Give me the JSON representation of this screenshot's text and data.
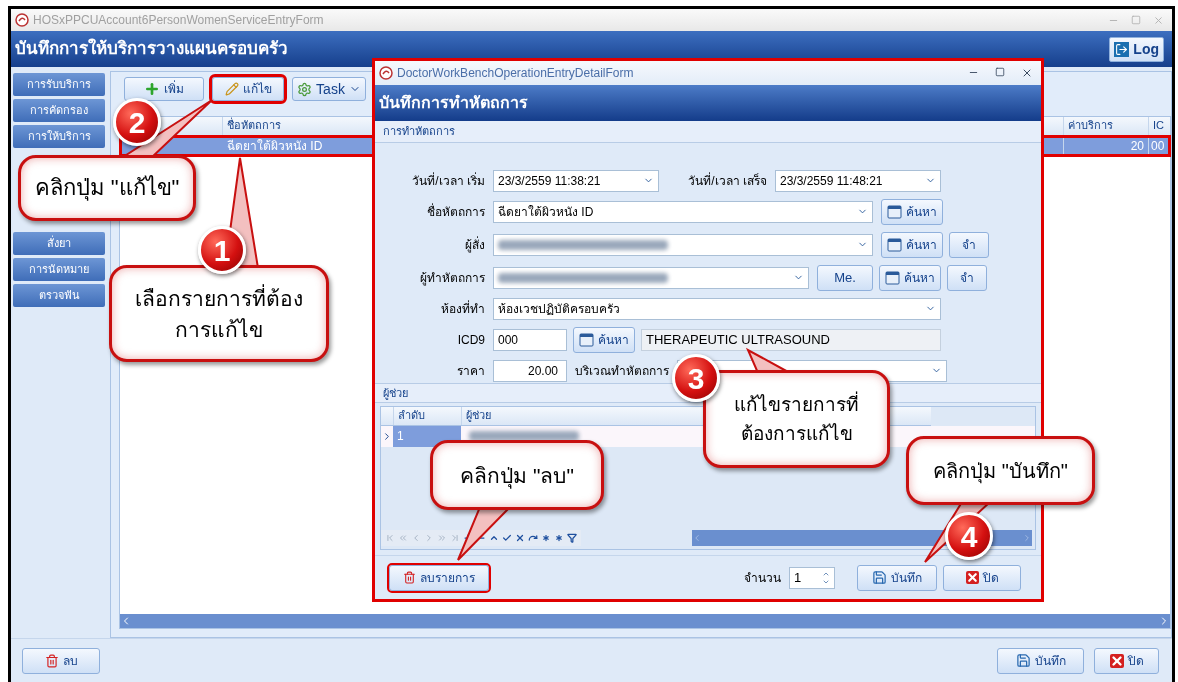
{
  "window": {
    "title": "HOSxPPCUAccount6PersonWomenServiceEntryForm",
    "header": "บันทึกการให้บริการวางแผนครอบครัว",
    "log_button": "Log"
  },
  "sidebar": {
    "items_top": [
      {
        "label": "การรับบริการ"
      },
      {
        "label": "การคัดกรอง"
      },
      {
        "label": "การให้บริการ"
      }
    ],
    "items_bottom": [
      {
        "label": "สั่งยา"
      },
      {
        "label": "การนัดหมาย"
      },
      {
        "label": "ตรวจฟัน"
      }
    ]
  },
  "toolbar": [
    {
      "label": "เพิ่ม",
      "kind": "add",
      "highlighted": false
    },
    {
      "label": "แก้ไข",
      "kind": "edit",
      "highlighted": true
    },
    {
      "label": "Task",
      "kind": "menu",
      "highlighted": false
    }
  ],
  "table": {
    "columns": [
      "ชื่อหัตถการ",
      "ค่าบริการ",
      "IC"
    ],
    "rows": [
      {
        "cells": [
          "ฉีดยาใต้ผิวหนัง ID",
          "20",
          "00"
        ],
        "selected": true,
        "highlighted": true
      }
    ]
  },
  "bottom_buttons": [
    {
      "label": "ลบ",
      "kind": "delete"
    },
    {
      "label": "บันทึก",
      "kind": "save"
    },
    {
      "label": "ปิด",
      "kind": "close"
    }
  ],
  "dialog": {
    "title": "DoctorWorkBenchOperationEntryDetailForm",
    "header": "บันทึกการทำหัตถการ",
    "section": "การทำหัตถการ",
    "highlighted": true,
    "start_label": "วันที่/เวลา เริ่ม",
    "start_value": "23/3/2559 11:38:21",
    "end_label": "วันที่/เวลา เสร็จ",
    "end_value": "23/3/2559 11:48:21",
    "operation_label": "ชื่อหัตถการ",
    "operation_value": "ฉีดยาใต้ผิวหนัง ID",
    "orderer_label": "ผู้สั่ง",
    "orderer_redacted": true,
    "operator_label": "ผู้ทำหัตถการ",
    "operator_redacted": true,
    "room_label": "ห้องที่ทำ",
    "room_value": "ห้องเวชปฏิบัติครอบครัว",
    "icd9_label": "ICD9",
    "icd9_value": "000",
    "icd9_description": "THERAPEUTIC ULTRASOUND",
    "price_label": "ราคา",
    "price_value": "20.00",
    "area_label": "บริเวณทำหัตถการ",
    "operation_search_button": "ค้นหา",
    "orderer_search_button": "ค้นหา",
    "orderer_remember_button": "จำ",
    "operator_search_button": "ค้นหา",
    "operator_remember_button": "จำ",
    "icd9_search_button": "ค้นหา",
    "me_button": "Me.",
    "assistant_section": "ผู้ช่วย",
    "assistant_columns": [
      "ลำดับ",
      "ผู้ช่วย"
    ],
    "assistant_rows": [
      {
        "order": "1",
        "redacted": true,
        "selected": true
      }
    ],
    "delete_button": {
      "label": "ลบรายการ",
      "highlighted": true
    },
    "quantity_label": "จำนวน",
    "quantity_value": "1",
    "save_button": "บันทึก",
    "close_button": "ปิด"
  },
  "callouts": [
    {
      "lines": [
        "คลิกปุ่ม \"แก้ไข\""
      ],
      "number": "2"
    },
    {
      "lines": [
        "เลือกรายการที่ต้อง",
        "การแก้ไข"
      ],
      "number": "1"
    },
    {
      "lines": [
        "แก้ไขรายการที่",
        "ต้องการแก้ไข"
      ],
      "number": "3"
    },
    {
      "lines": [
        "คลิกปุ่ม \"ลบ\""
      ]
    },
    {
      "lines": [
        "คลิกปุ่ม \"บันทึก\""
      ],
      "number": "4"
    }
  ]
}
